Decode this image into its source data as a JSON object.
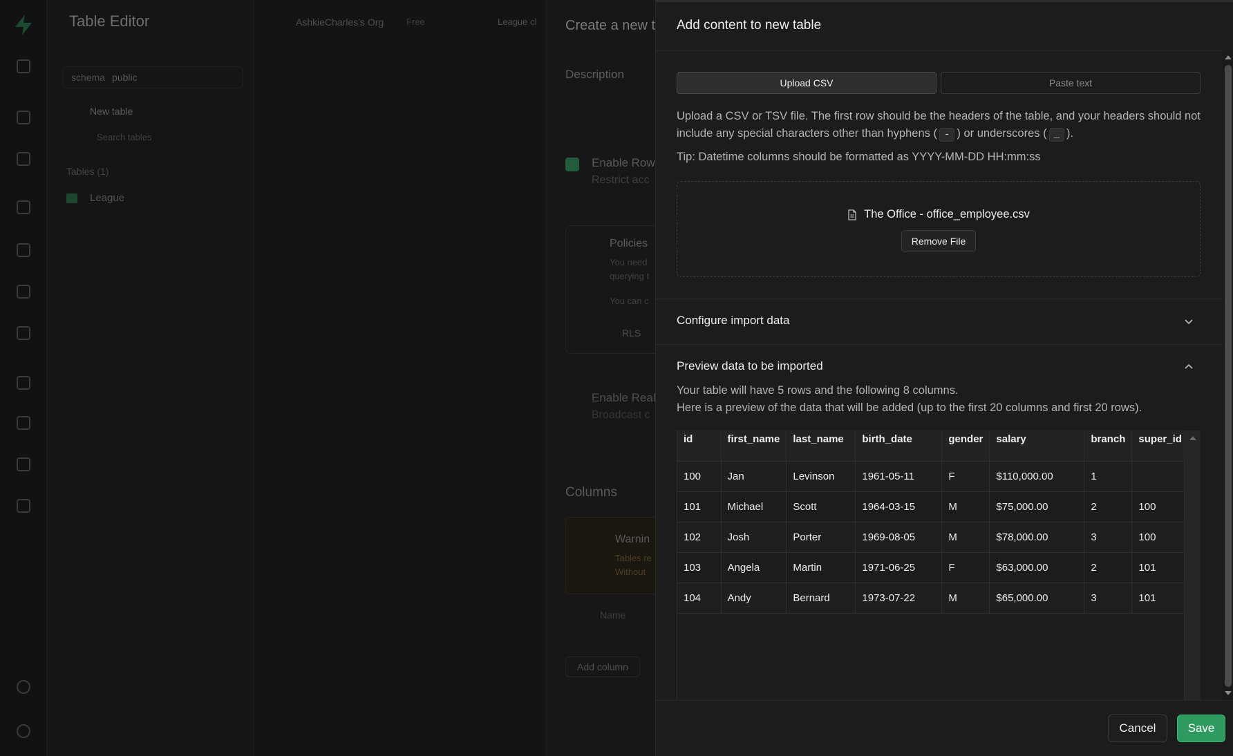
{
  "background": {
    "app_title": "Table Editor",
    "org_name": "AshkieCharles's Org",
    "plan": "Free",
    "breadcrumb": "League cl",
    "schema_label": "schema",
    "schema_value": "public",
    "new_table": "New table",
    "search_tables": "Search tables",
    "tables_heading": "Tables (1)",
    "table_item": "League",
    "create_title": "Create a new t",
    "description_label": "Description",
    "rls_label": "Enable Row",
    "rls_desc": "Restrict acc",
    "policies_title": "Policies",
    "policies_line1": "You need",
    "policies_line2": "querying t",
    "policies_line3": "You can c",
    "rls_button": "RLS",
    "realtime_label": "Enable Real",
    "realtime_desc": "Broadcast c",
    "columns_heading": "Columns",
    "warning_title": "Warnin",
    "warning_line1": "Tables re",
    "warning_line2": "Without",
    "name_label": "Name",
    "add_column": "Add column"
  },
  "sheet": {
    "title": "Add content to new table",
    "tabs": [
      {
        "label": "Upload CSV",
        "active": true
      },
      {
        "label": "Paste text",
        "active": false
      }
    ],
    "instructions_part1": "Upload a CSV or TSV file. The first row should be the headers of the table, and your headers should not include any special characters other than hyphens (",
    "hyphen": "-",
    "instructions_part2": ") or underscores (",
    "underscore": "_",
    "instructions_part3": ").",
    "tip": "Tip: Datetime columns should be formatted as YYYY-MM-DD HH:mm:ss",
    "file_name": "The Office - office_employee.csv",
    "remove_file": "Remove File",
    "configure_title": "Configure import data",
    "preview_title": "Preview data to be imported",
    "preview_line1": "Your table will have 5 rows and the following 8 columns.",
    "preview_line2": "Here is a preview of the data that will be added (up to the first 20 columns and first 20 rows).",
    "columns": [
      "id",
      "first_name",
      "last_name",
      "birth_date",
      "gender",
      "salary",
      "branch",
      "super_id"
    ],
    "rows": [
      [
        "100",
        "Jan",
        "Levinson",
        "1961-05-11",
        "F",
        "$110,000.00",
        "1",
        ""
      ],
      [
        "101",
        "Michael",
        "Scott",
        "1964-03-15",
        "M",
        "$75,000.00",
        "2",
        "100"
      ],
      [
        "102",
        "Josh",
        "Porter",
        "1969-08-05",
        "M",
        "$78,000.00",
        "3",
        "100"
      ],
      [
        "103",
        "Angela",
        "Martin",
        "1971-06-25",
        "F",
        "$63,000.00",
        "2",
        "101"
      ],
      [
        "104",
        "Andy",
        "Bernard",
        "1973-07-22",
        "M",
        "$65,000.00",
        "3",
        "101"
      ]
    ],
    "cancel": "Cancel",
    "save": "Save"
  },
  "colors": {
    "accent_green": "#2e9a5e",
    "sheet_bg": "#1c1c1c",
    "text": "#ededed"
  }
}
